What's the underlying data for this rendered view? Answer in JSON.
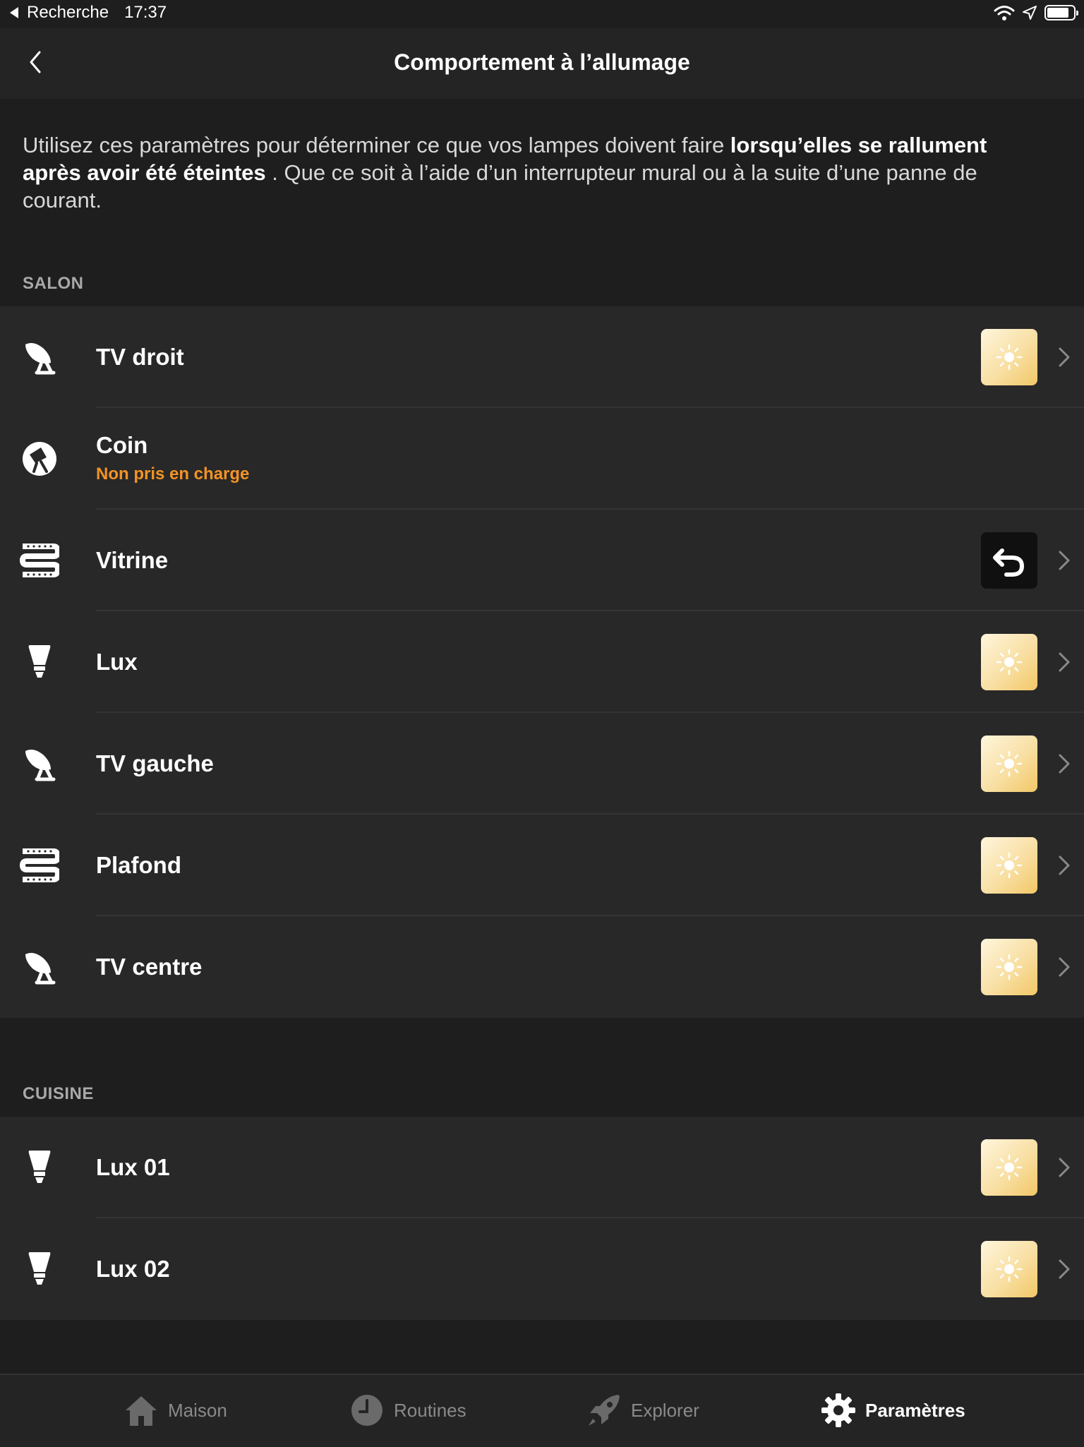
{
  "status_bar": {
    "back_app": "Recherche",
    "time": "17:37"
  },
  "nav": {
    "title": "Comportement à l’allumage"
  },
  "description": {
    "part1": "Utilisez ces paramètres pour déterminer ce que vos lampes doivent faire ",
    "bold": "lorsqu’elles se rallument après avoir été éteintes",
    "part2": " . Que ce soit à l’aide d’un interrupteur mural ou à la suite d’une panne de courant."
  },
  "sections": [
    {
      "title": "SALON",
      "rows": [
        {
          "label": "TV droit",
          "icon": "spot-lamp-icon",
          "state": "light-on"
        },
        {
          "label": "Coin",
          "icon": "floor-lamp-icon",
          "subtitle": "Non pris en charge"
        },
        {
          "label": "Vitrine",
          "icon": "lightstrip-icon",
          "state": "restore"
        },
        {
          "label": "Lux",
          "icon": "bulb-icon",
          "state": "light-on"
        },
        {
          "label": "TV gauche",
          "icon": "spot-lamp-icon",
          "state": "light-on"
        },
        {
          "label": "Plafond",
          "icon": "lightstrip-icon",
          "state": "light-on"
        },
        {
          "label": "TV centre",
          "icon": "spot-lamp-icon",
          "state": "light-on"
        }
      ]
    },
    {
      "title": "CUISINE",
      "rows": [
        {
          "label": "Lux 01",
          "icon": "bulb-icon",
          "state": "light-on"
        },
        {
          "label": "Lux 02",
          "icon": "bulb-icon",
          "state": "light-on"
        }
      ]
    }
  ],
  "tabs": [
    {
      "label": "Maison",
      "icon": "home-icon",
      "active": false
    },
    {
      "label": "Routines",
      "icon": "clock-icon",
      "active": false
    },
    {
      "label": "Explorer",
      "icon": "rocket-icon",
      "active": false
    },
    {
      "label": "Paramètres",
      "icon": "gear-icon",
      "active": true
    }
  ],
  "colors": {
    "accent_warning": "#f39325",
    "tile_warm": "#f8dfa3",
    "background": "#1e1e1e",
    "row_bg": "#282828"
  }
}
